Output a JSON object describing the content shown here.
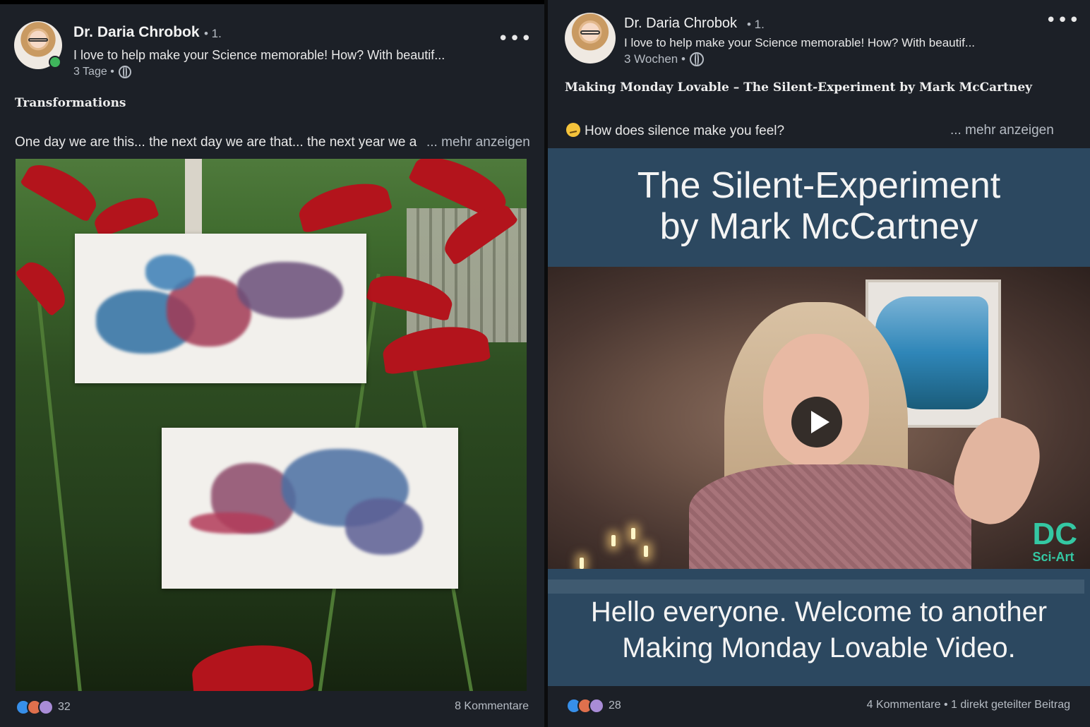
{
  "posts": [
    {
      "author": "Dr. Daria Chrobok",
      "degree": "• 1.",
      "headline": "I love to help make your Science memorable! How? With beautif...",
      "time": "3 Tage •",
      "title": "Transformations",
      "body": "One day we are this... the next day we are that... the next year we a",
      "more_label": "... mehr anzeigen",
      "reaction_count": "32",
      "stats": "8 Kommentare",
      "icons": {
        "more": "more-horizontal-icon",
        "visibility": "globe-icon"
      }
    },
    {
      "author": "Dr. Daria Chrobok",
      "degree": "• 1.",
      "headline": "I love to help make your Science memorable! How? With beautif...",
      "time": "3 Wochen •",
      "title": "Making Monday Lovable – The Silent-Experiment by Mark McCartney",
      "body": "How does silence make you feel?",
      "body_emoji": "thinking-face-emoji",
      "more_label": "... mehr anzeigen",
      "video": {
        "title_line1": "The Silent-Experiment",
        "title_line2": "by Mark McCartney",
        "caption_line1": "Hello everyone. Welcome to another",
        "caption_line2": "Making Monday Lovable Video.",
        "logo_mark": "DC",
        "logo_text": "Sci-Art"
      },
      "reaction_count": "28",
      "stats": "4 Kommentare • 1 direkt geteilter Beitrag",
      "icons": {
        "more": "more-horizontal-icon",
        "visibility": "globe-icon",
        "play": "play-icon"
      }
    }
  ],
  "colors": {
    "background": "#1c2027",
    "text": "#e8e8e8",
    "muted": "#b6bcc4",
    "video_bg": "#2c4860",
    "online": "#3fb55c",
    "like": "#378fe9",
    "love": "#df704d",
    "support": "#a98cd7"
  }
}
